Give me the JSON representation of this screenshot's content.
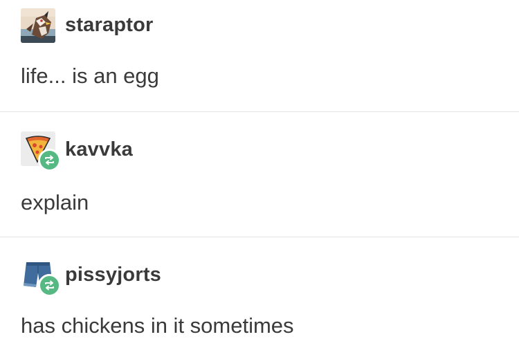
{
  "thread": [
    {
      "username": "staraptor",
      "avatar": "staraptor-bird-avatar",
      "reblogged": false,
      "text": "life... is an egg"
    },
    {
      "username": "kavvka",
      "avatar": "pizza-slice-avatar",
      "reblogged": true,
      "reblog_icon": "reblog-icon",
      "text": "explain"
    },
    {
      "username": "pissyjorts",
      "avatar": "jean-shorts-avatar",
      "reblogged": true,
      "reblog_icon": "reblog-icon",
      "text": "has chickens in it sometimes"
    }
  ],
  "colors": {
    "reblog_badge": "#56b983",
    "text": "#3a3a3a",
    "divider": "#e2e2e2"
  }
}
